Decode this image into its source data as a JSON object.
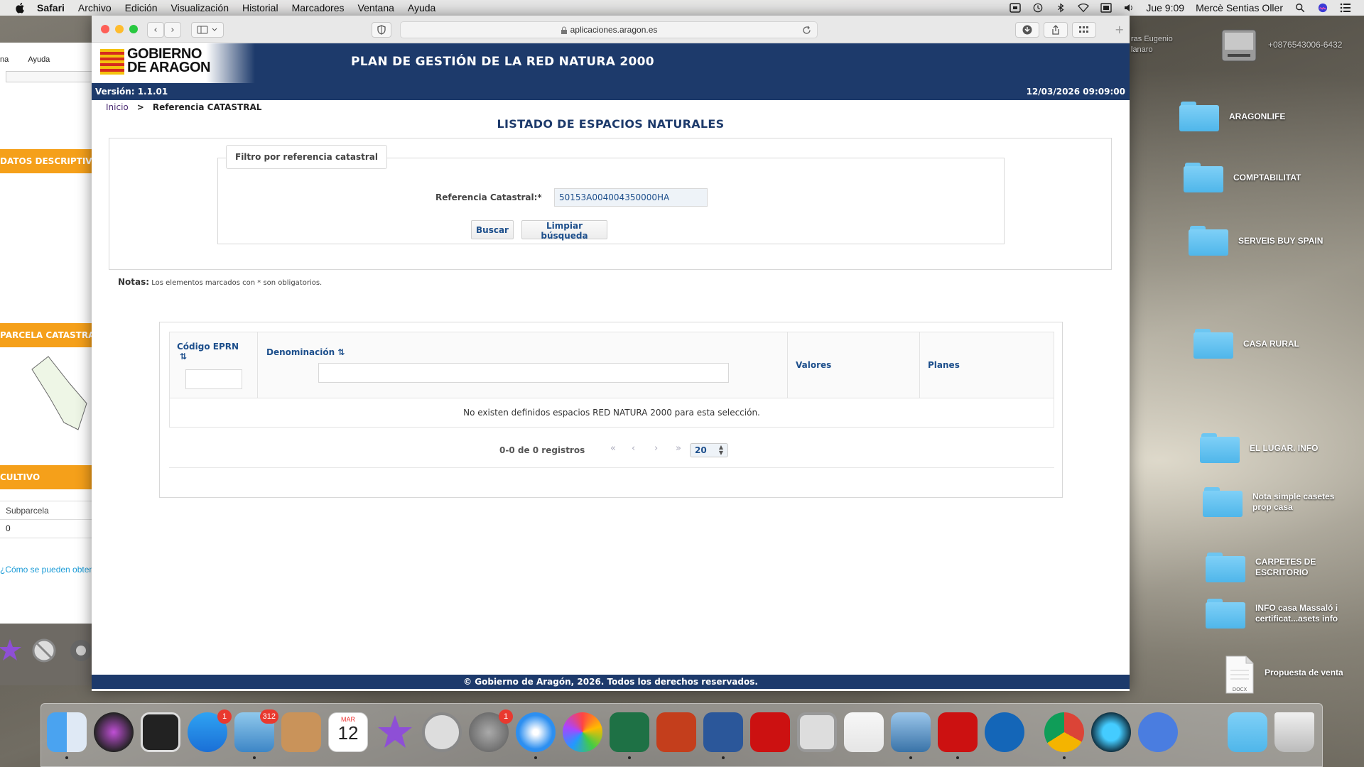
{
  "menubar": {
    "app": "Safari",
    "items": [
      "Archivo",
      "Edición",
      "Visualización",
      "Historial",
      "Marcadores",
      "Ventana",
      "Ayuda"
    ],
    "clock": "Jue 9:09",
    "user": "Mercè Sentias Oller"
  },
  "browser": {
    "url": "aplicaciones.aragon.es"
  },
  "background_window": {
    "menu": [
      "na",
      "Ayuda"
    ],
    "sections": [
      "DATOS DESCRIPTIVOS",
      "PARCELA CATASTRAL",
      "CULTIVO"
    ],
    "subparcela_label": "Subparcela",
    "subparcela_value": "0",
    "link": "¿Cómo se pueden obtener"
  },
  "header": {
    "logo_line1": "GOBIERNO",
    "logo_line2": "DE ARAGON",
    "title": "PLAN DE GESTIÓN DE LA RED NATURA 2000",
    "version": "Versión: 1.1.01",
    "datetime": "12/03/2026 09:09:00"
  },
  "breadcrumb": {
    "home": "Inicio",
    "separator": ">",
    "current": "Referencia CATASTRAL"
  },
  "list_title": "LISTADO DE ESPACIOS NATURALES",
  "filter": {
    "legend": "Filtro por referencia catastral",
    "ref_label": "Referencia Catastral:*",
    "ref_value": "50153A004004350000HA",
    "search_button": "Buscar",
    "clear_button": "Limpiar búsqueda",
    "notes_label": "Notas:",
    "notes_text": "Los elementos marcados con * son obligatorios."
  },
  "table": {
    "columns": [
      "Código EPRN",
      "Denominación",
      "Valores",
      "Planes"
    ],
    "sort_glyph": "⇅",
    "empty_message": "No existen definidos espacios RED NATURA 2000 para esta selección.",
    "pager_info": "0-0 de 0 registros",
    "page_size": "20"
  },
  "footer": "© Gobierno de Aragón, 2026. Todos los derechos reservados.",
  "desktop": {
    "top_label": "ras Eugenio lanaro",
    "disk_label": "+0876543006-6432",
    "icons": [
      "ARAGONLIFE",
      "COMPTABILITAT",
      "SERVEIS BUY SPAIN",
      "CASA RURAL",
      "EL LUGAR. INFO",
      "Nota simple casetes prop casa",
      "CARPETES DE ESCRITORIO",
      "INFO casa Massaló i certificat...asets info",
      "Propuesta de venta"
    ],
    "docx_label": "DOCX"
  },
  "dock": {
    "appstore_badge": "1",
    "mail_badge": "312",
    "calendar_month": "MAR",
    "calendar_day": "12",
    "prefs_badge": "1"
  },
  "colors": {
    "navy": "#1d3a6b",
    "link_blue": "#1d4f8c",
    "orange": "#f5a01a",
    "folder_blue": "#4fb6ea"
  }
}
